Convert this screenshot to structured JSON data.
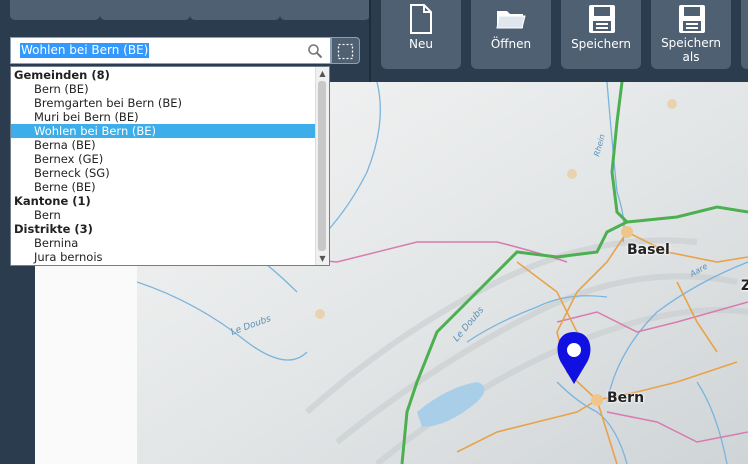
{
  "toolbar": {
    "buttons": [
      {
        "label": "Neu",
        "icon": "new-document-icon"
      },
      {
        "label": "Öffnen",
        "icon": "folder-open-icon"
      },
      {
        "label": "Speichern",
        "icon": "save-icon"
      },
      {
        "label": "Speichern\nals",
        "icon": "save-as-icon"
      }
    ]
  },
  "search": {
    "value": "Wohlen bei Bern (BE)",
    "icon": "search-icon",
    "select_icon": "selection-box-icon"
  },
  "dropdown": {
    "groups": [
      {
        "heading": "Gemeinden (8)",
        "items": [
          "Bern (BE)",
          "Bremgarten bei Bern (BE)",
          "Muri bei Bern (BE)",
          "Wohlen bei Bern (BE)",
          "Berna (BE)",
          "Bernex (GE)",
          "Berneck (SG)",
          "Berne (BE)"
        ]
      },
      {
        "heading": "Kantone (1)",
        "items": [
          "Bern"
        ]
      },
      {
        "heading": "Distrikte (3)",
        "items": [
          "Bernina",
          "Jura bernois"
        ]
      }
    ],
    "selected": "Wohlen bei Bern (BE)"
  },
  "map": {
    "labels": {
      "basel": "Basel",
      "bern": "Bern",
      "z": "Z",
      "doubs": "Le Doubs",
      "doubs2": "Le Doubs",
      "rhein": "Rhein",
      "aare": "Aare"
    },
    "marker_icon": "map-pin-icon",
    "colors": {
      "border": "#4caf50",
      "canton_border": "#d77bb0",
      "roads": "#e8a34a",
      "rivers": "#7ab4dd"
    }
  }
}
